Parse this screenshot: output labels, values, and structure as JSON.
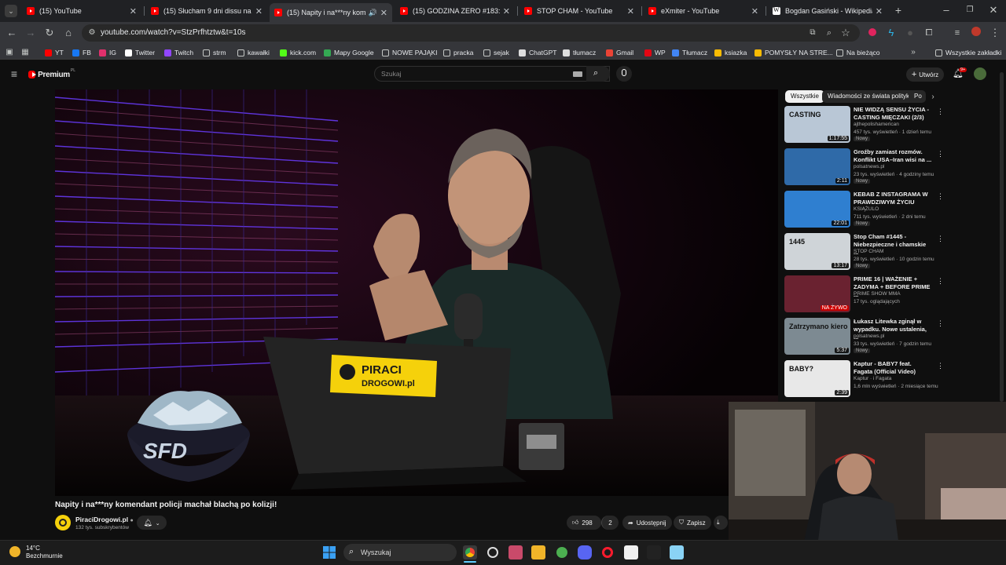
{
  "tabs": [
    {
      "title": "(15) YouTube",
      "active": false
    },
    {
      "title": "(15) Słucham 9 dni dissu na rak",
      "active": false
    },
    {
      "title": "(15) Napity i na***ny komen",
      "active": true
    },
    {
      "title": "(15) GODZINA ZERO #183: KRZ",
      "active": false
    },
    {
      "title": "STOP CHAM - YouTube",
      "active": false
    },
    {
      "title": "eXmiter - YouTube",
      "active": false
    },
    {
      "title": "Bogdan Gasiński - Wikipedia",
      "active": false
    }
  ],
  "address_bar": {
    "url": "youtube.com/watch?v=StzPrfhtztw&t=10s"
  },
  "bookmarks": [
    {
      "label": "YT",
      "color": "#ff0000"
    },
    {
      "label": "FB",
      "color": "#1877f2"
    },
    {
      "label": "IG",
      "color": "#e1306c"
    },
    {
      "label": "Twitter",
      "color": "#ffffff"
    },
    {
      "label": "Twitch",
      "color": "#9146ff"
    },
    {
      "label": "strm",
      "color": "folder"
    },
    {
      "label": "kawałki",
      "color": "folder"
    },
    {
      "label": "kick.com",
      "color": "#53fc18"
    },
    {
      "label": "Mapy Google",
      "color": "#34a853"
    },
    {
      "label": "NOWE PAJĄKI",
      "color": "folder"
    },
    {
      "label": "pracka",
      "color": "folder"
    },
    {
      "label": "sejak",
      "color": "folder"
    },
    {
      "label": "ChatGPT",
      "color": "#dddddd"
    },
    {
      "label": "tłumacz",
      "color": "#dddddd"
    },
    {
      "label": "Gmail",
      "color": "#ea4335"
    },
    {
      "label": "WP",
      "color": "#e30613"
    },
    {
      "label": "Tłumacz",
      "color": "#4285f4"
    },
    {
      "label": "ksiazka",
      "color": "#fbbc04"
    },
    {
      "label": "POMYSŁY NA STRE...",
      "color": "#fbbc04"
    },
    {
      "label": "Na bieżąco",
      "color": "folder"
    }
  ],
  "all_bookmarks_label": "Wszystkie zakładki",
  "youtube": {
    "logo": "Premium",
    "logo_suffix": "PL",
    "search_placeholder": "Szukaj",
    "create_label": "Utwórz",
    "notifications_badge": "9+"
  },
  "video": {
    "title": "Napity i na***ny komendant policji machał blachą po kolizji!",
    "channel": "PiraciDrogowi.pl",
    "subscribers": "132 tys. subskrybentów",
    "laptop_sticker_line1": "PIRACI",
    "laptop_sticker_line2": "DROGOWI.pl",
    "likes": "298",
    "dislike_count": "2",
    "share_label": "Udostępnij",
    "save_label": "Zapisz"
  },
  "filter_chips": [
    "Wszystkie",
    "Wiadomości ze świata polityki",
    "Po"
  ],
  "recommendations": [
    {
      "title": "NIE WIDZĄ SENSU ŻYCIA - CASTING MIĘCZAKI (2/3)",
      "channel": "ajthepolishamerican",
      "views": "457 tys. wyświetleń · 1 dzień temu",
      "badge": "Nowy",
      "duration": "1:17:55",
      "thumb_text": "CASTING"
    },
    {
      "title": "Groźby zamiast rozmów. Konflikt USA–Iran wisi na ...",
      "channel": "polsatnews.pl",
      "views": "23 tys. wyświetleń · 4 godziny temu",
      "badge": "Nowy",
      "duration": "2:11",
      "thumb_text": ""
    },
    {
      "title": "KEBAB Z INSTAGRAMA W PRAWDZIWYM ŻYCIU",
      "channel": "KSIĄŻULO",
      "views": "711 tys. wyświetleń · 2 dni temu",
      "badge": "Nowy",
      "duration": "22:01",
      "thumb_text": ""
    },
    {
      "title": "Stop Cham #1445 - Niebezpieczne i chamskie ...",
      "channel": "STOP CHAM",
      "views": "28 tys. wyświetleń · 10 godzin temu",
      "badge": "Nowy",
      "duration": "13:17",
      "thumb_text": "1445"
    },
    {
      "title": "PRIME 16 | WAŻENIE + ZADYMA + BEFORE PRIME ...",
      "channel": "PRIME SHOW MMA",
      "views": "17 tys. oglądających",
      "badge": "",
      "duration": "NA ŻYWO",
      "thumb_text": ""
    },
    {
      "title": "Łukasz Litewka zginął w wypadku. Nowe ustalenia, ...",
      "channel": "polsatnews.pl",
      "views": "33 tys. wyświetleń · 7 godzin temu",
      "badge": "Nowy",
      "duration": "5:37",
      "thumb_text": "Zatrzymano kiero"
    },
    {
      "title": "Kaptur - BABY7 feat. Fagata (Official Video)",
      "channel": "Kaptur · i Fagata",
      "views": "1,6 mln wyświetleń · 2 miesiące temu",
      "badge": "",
      "duration": "2:39",
      "thumb_text": "BABY?"
    }
  ],
  "taskbar": {
    "weather_temp": "14°C",
    "weather_desc": "Bezchmurnie",
    "search_placeholder": "Wyszukaj"
  },
  "colors": {
    "accent_red": "#ff0000",
    "bg": "#0f0f0f",
    "sticker_yellow": "#f5d10b"
  }
}
